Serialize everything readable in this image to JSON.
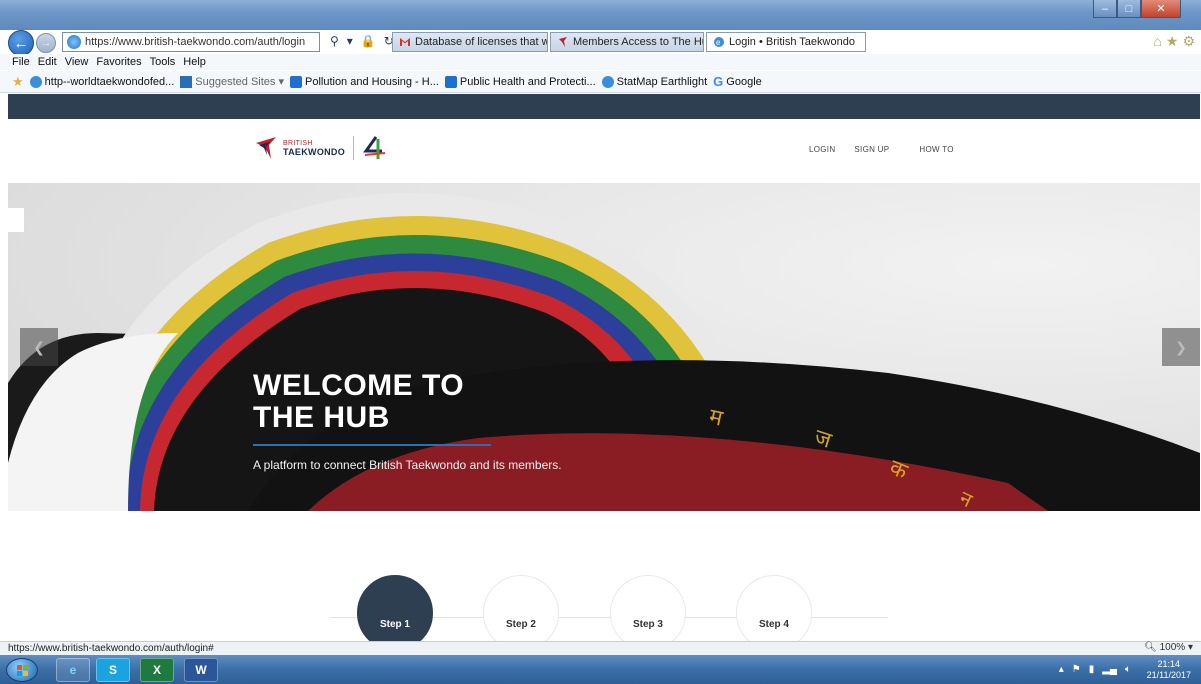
{
  "browser": {
    "url": "https://www.british-taekwondo.com/auth/login",
    "tabs": [
      {
        "label": "Database of licenses that were...",
        "icon": "gmail-icon"
      },
      {
        "label": "Members Access to The Hub - ...",
        "icon": "british-taekwondo-icon"
      },
      {
        "label": "Login • British Taekwondo",
        "icon": "ie-icon",
        "active": true
      }
    ],
    "tab_close": "×",
    "menu": [
      "File",
      "Edit",
      "View",
      "Favorites",
      "Tools",
      "Help"
    ],
    "favorites": [
      {
        "label": "http--worldtaekwondofed...",
        "icon": "ie-icon"
      },
      {
        "label": "Suggested Sites ▾",
        "icon": "suggested-sites-icon",
        "muted": true
      },
      {
        "label": "Pollution and Housing - H...",
        "icon": "sharepoint-icon"
      },
      {
        "label": "Public Health and Protecti...",
        "icon": "sharepoint-icon"
      },
      {
        "label": "StatMap Earthlight",
        "icon": "ie-icon"
      },
      {
        "label": "Google",
        "icon": "google-icon"
      }
    ],
    "status_url": "https://www.british-taekwondo.com/auth/login#",
    "zoom": "100%"
  },
  "site": {
    "logo": {
      "line1": "BRITISH",
      "line2": "TAEKWONDO"
    },
    "nav": [
      "LOGIN",
      "SIGN UP",
      "HOW TO"
    ],
    "hero": {
      "title_line1": "WELCOME TO",
      "title_line2": "THE HUB",
      "subtitle": "A platform to connect British Taekwondo and its members."
    },
    "steps": [
      {
        "label": "Step 1",
        "active": true
      },
      {
        "label": "Step 2",
        "active": false
      },
      {
        "label": "Step 3",
        "active": false
      },
      {
        "label": "Step 4",
        "active": false
      }
    ]
  },
  "taskbar": {
    "time": "21:14",
    "date": "21/11/2017"
  }
}
